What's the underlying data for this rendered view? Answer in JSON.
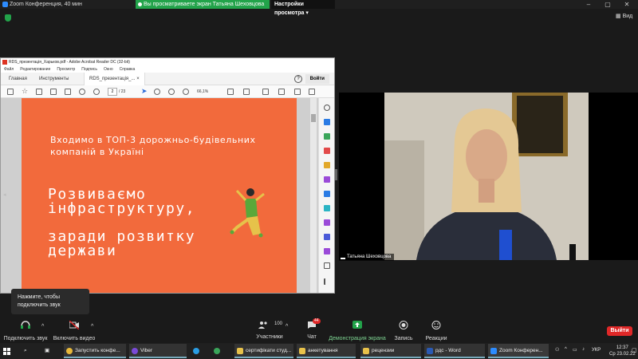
{
  "titlebar": {
    "app_title": "Zoom Конференция, 40 мин",
    "share_banner": "Вы просматриваете экран Татьяна Шеховцова",
    "view_settings": "Настройки просмотра",
    "view_label": "Вид"
  },
  "acrobat": {
    "title": "RDS_презентація_Харьков.pdf - Adobe Acrobat Reader DC (32-bit)",
    "menu": [
      "Файл",
      "Редактирование",
      "Просмотр",
      "Подпись",
      "Окно",
      "Справка"
    ],
    "tabs": {
      "home": "Главная",
      "tools": "Инструменты",
      "doc": "RDS_презентація_..."
    },
    "tab_close": "×",
    "help": "?",
    "sign_in": "Войти",
    "page_current": "2",
    "page_total": "/ 23",
    "zoom": "66,1%"
  },
  "slide": {
    "subtitle_line1": "Входимо в ТОП-3 дорожньо-будівельних",
    "subtitle_line2": "компаній в Україні",
    "heading1_line1": "Розвиваємо",
    "heading1_line2": "інфраструктуру,",
    "heading2_line1": "заради розвитку",
    "heading2_line2": "держави"
  },
  "video": {
    "participant_name": "Татьяна Шеховцова"
  },
  "tooltip": {
    "line1": "Нажмите, чтобы",
    "line2": "подключить звук"
  },
  "zoom_toolbar": {
    "audio": "Подключить звук",
    "video": "Включить видео",
    "participants": "Участники",
    "participants_count": "100",
    "chat": "Чат",
    "chat_badge": "44",
    "share": "Демонстрация экрана",
    "record": "Запись",
    "reactions": "Реакции",
    "leave": "Выйти"
  },
  "taskbar": {
    "chrome": "Запустить конфе...",
    "viber": "Viber",
    "folder1": "сертифікати студ...",
    "folder2": "анкетування",
    "folder3": "рецензии",
    "word": "рдс - Word",
    "zoom": "Zoom Конферен...",
    "lang": "УКР",
    "time": "12:37",
    "date": "Ср 23.02.22"
  },
  "colors": {
    "slide_bg": "#f26a3c",
    "share_green": "#22a34a",
    "leave_red": "#e02828"
  }
}
